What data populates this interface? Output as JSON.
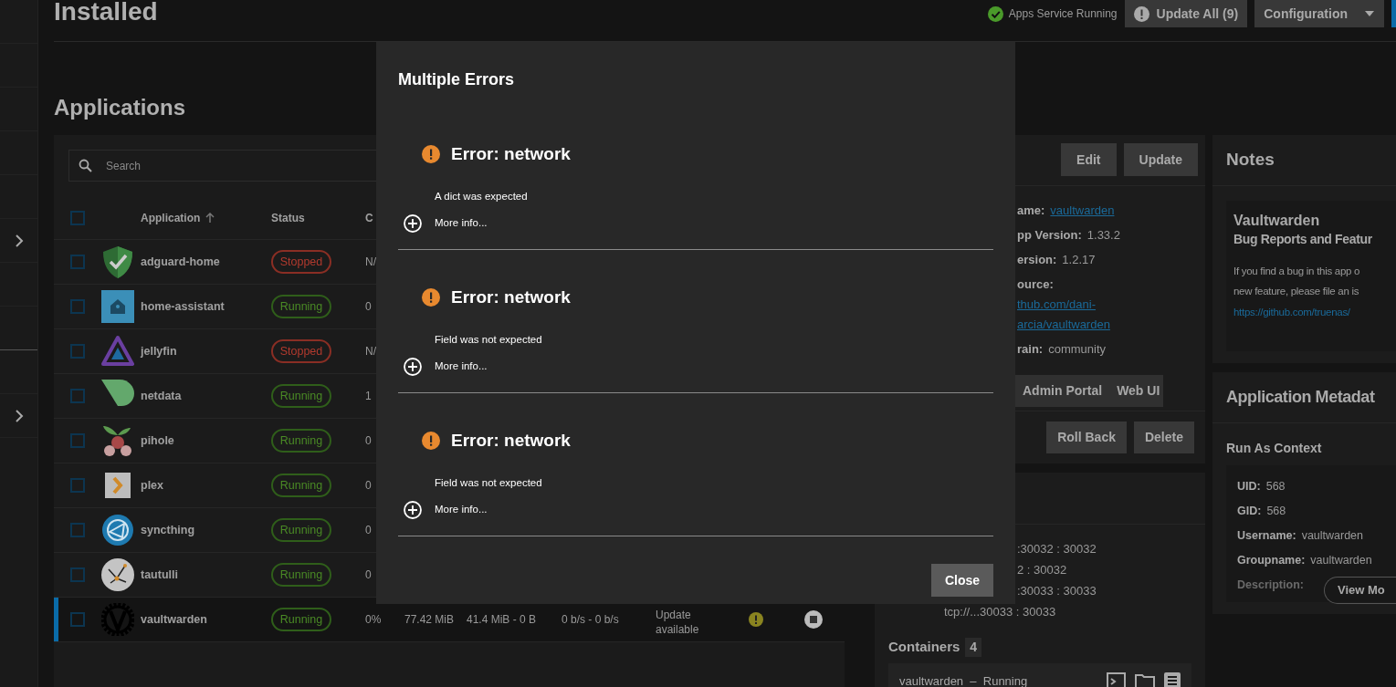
{
  "page_title": "Installed",
  "service_status": {
    "label": "Apps Service Running"
  },
  "header_buttons": [
    {
      "label": "Update All (9)",
      "kind": "update"
    },
    {
      "label": "Configuration",
      "kind": "menu"
    }
  ],
  "section_title": "Applications",
  "search": {
    "placeholder": "Search"
  },
  "table": {
    "header_checked": false,
    "columns": [
      {
        "label": "Application",
        "sorted_ascending": true
      },
      {
        "label": "Status",
        "sorted_ascending": false
      },
      {
        "label": "C",
        "sorted_ascending": false
      }
    ],
    "rows": [
      {
        "name": "adguard-home",
        "status": "Stopped",
        "running": false,
        "cpu": "N/",
        "checked": false,
        "selected": false
      },
      {
        "name": "home-assistant",
        "status": "Running",
        "running": true,
        "cpu": "0",
        "checked": false,
        "selected": false
      },
      {
        "name": "jellyfin",
        "status": "Stopped",
        "running": false,
        "cpu": "N/",
        "checked": false,
        "selected": false
      },
      {
        "name": "netdata",
        "status": "Running",
        "running": true,
        "cpu": "1",
        "checked": false,
        "selected": false
      },
      {
        "name": "pihole",
        "status": "Running",
        "running": true,
        "cpu": "0",
        "checked": false,
        "selected": false
      },
      {
        "name": "plex",
        "status": "Running",
        "running": true,
        "cpu": "0",
        "checked": false,
        "selected": false
      },
      {
        "name": "syncthing",
        "status": "Running",
        "running": true,
        "cpu": "0",
        "checked": false,
        "selected": false
      },
      {
        "name": "tautulli",
        "status": "Running",
        "running": true,
        "cpu": "0",
        "checked": false,
        "selected": false
      },
      {
        "name": "vaultwarden",
        "status": "Running",
        "running": true,
        "cpu": "0%",
        "memory": "77.42 MiB",
        "block_io": "41.4 MiB - 0 B",
        "network": "0 b/s - 0 b/s",
        "state": "Update available",
        "update_available": true,
        "checked": false,
        "selected": true
      }
    ]
  },
  "details": {
    "buttons": [
      "Edit",
      "Update"
    ],
    "fields": [
      {
        "label": "ame:",
        "value": "vaultwarden",
        "kind": "link"
      },
      {
        "label": "pp Version:",
        "value": "1.33.2",
        "kind": "text"
      },
      {
        "label": "ersion:",
        "value": "1.2.17",
        "kind": "text"
      },
      {
        "label": "ource:",
        "kind": "heading"
      },
      {
        "value": "thub.com/dani-",
        "kind": "link_line"
      },
      {
        "value": "arcia/vaultwarden",
        "kind": "link_line"
      },
      {
        "label": "rain:",
        "value": "community",
        "kind": "text"
      }
    ],
    "portal_buttons": [
      "Admin Portal",
      "Web UI"
    ],
    "action_buttons": [
      "Roll Back",
      "Delete"
    ]
  },
  "ports": [
    {
      "text": ":30032 : 30032",
      "kind": "clipped"
    },
    {
      "text": "2 : 30032",
      "kind": "clipped"
    },
    {
      "text": ":30033 : 30033",
      "kind": "clipped"
    },
    {
      "text": "tcp://...30033 : 30033",
      "kind": "whole"
    }
  ],
  "containers": {
    "title": "Containers",
    "count": "4",
    "items": [
      {
        "label": "vaultwarden  –  Running"
      }
    ]
  },
  "notes": {
    "title": "Notes",
    "app_name": "Vaultwarden",
    "subtitle": "Bug Reports and Featur",
    "lines": [
      "If you find a bug in this app o",
      "new feature, please file an is"
    ],
    "link": "https://github.com/truenas/"
  },
  "metadata": {
    "title": "Application Metadat",
    "section": "Run As Context",
    "fields": [
      {
        "label": "UID:",
        "value": "568",
        "faded": false
      },
      {
        "label": "GID:",
        "value": "568",
        "faded": false
      },
      {
        "label": "Username:",
        "value": "vaultwarden",
        "faded": false
      },
      {
        "label": "Groupname:",
        "value": "vaultwarden",
        "faded": false
      },
      {
        "label": "Description:",
        "faded": true
      }
    ],
    "button": "View Mo"
  },
  "dialog": {
    "title": "Multiple Errors",
    "errors": [
      {
        "title": "Error: network",
        "message": "A dict was expected",
        "more": "More info..."
      },
      {
        "title": "Error: network",
        "message": "Field was not expected",
        "more": "More info..."
      },
      {
        "title": "Error: network",
        "message": "Field was not expected",
        "more": "More info..."
      }
    ],
    "close": "Close"
  }
}
